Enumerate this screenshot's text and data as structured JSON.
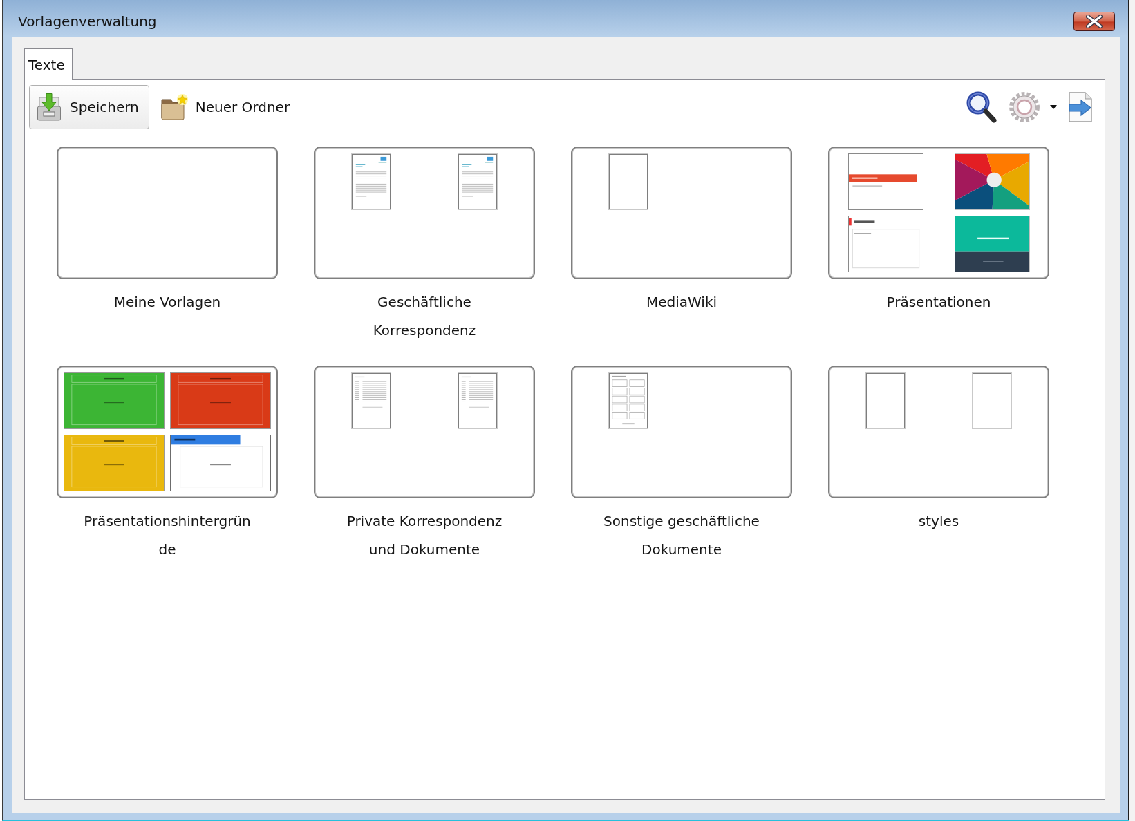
{
  "window": {
    "title": "Vorlagenverwaltung"
  },
  "tabs": [
    {
      "label": "Texte",
      "selected": true
    }
  ],
  "toolbar": {
    "actions": [
      {
        "kind": "save",
        "label": "Speichern",
        "highlighted": true
      },
      {
        "kind": "new-folder",
        "label": "Neuer Ordner",
        "highlighted": false
      }
    ],
    "tools": [
      {
        "kind": "search",
        "dropdown": false
      },
      {
        "kind": "settings",
        "dropdown": true
      },
      {
        "kind": "export",
        "dropdown": false
      }
    ]
  },
  "folders": [
    {
      "name": "Meine Vorlagen"
    },
    {
      "name": "Geschäftliche Korrespondenz",
      "thumbnails": [
        {
          "kind": "letterhead-page"
        },
        {
          "kind": "letterhead-page"
        }
      ]
    },
    {
      "name": "MediaWiki",
      "thumbnails": [
        {
          "kind": "blank-page"
        }
      ]
    },
    {
      "name": "Präsentationen",
      "thumbnails": [
        {
          "kind": "title-slide"
        },
        {
          "kind": "pinwheel-slide"
        },
        {
          "kind": "content-slide"
        },
        {
          "kind": "two-tone-slide"
        }
      ]
    },
    {
      "name": "Präsentationshintergründe",
      "thumbnails": [
        {
          "kind": "color-slide",
          "color": "#3cb534"
        },
        {
          "kind": "color-slide",
          "color": "#d93a17"
        },
        {
          "kind": "color-slide",
          "color": "#e9b80e"
        },
        {
          "kind": "banner-slide"
        }
      ]
    },
    {
      "name": "Private Korrespondenz und Dokumente",
      "thumbnails": [
        {
          "kind": "text-page"
        },
        {
          "kind": "text-page"
        }
      ]
    },
    {
      "name": "Sonstige geschäftliche Dokumente",
      "thumbnails": [
        {
          "kind": "form-page"
        }
      ]
    },
    {
      "name": "styles",
      "thumbnails": [
        {
          "kind": "blank-page"
        },
        {
          "kind": "blank-page"
        }
      ]
    }
  ]
}
